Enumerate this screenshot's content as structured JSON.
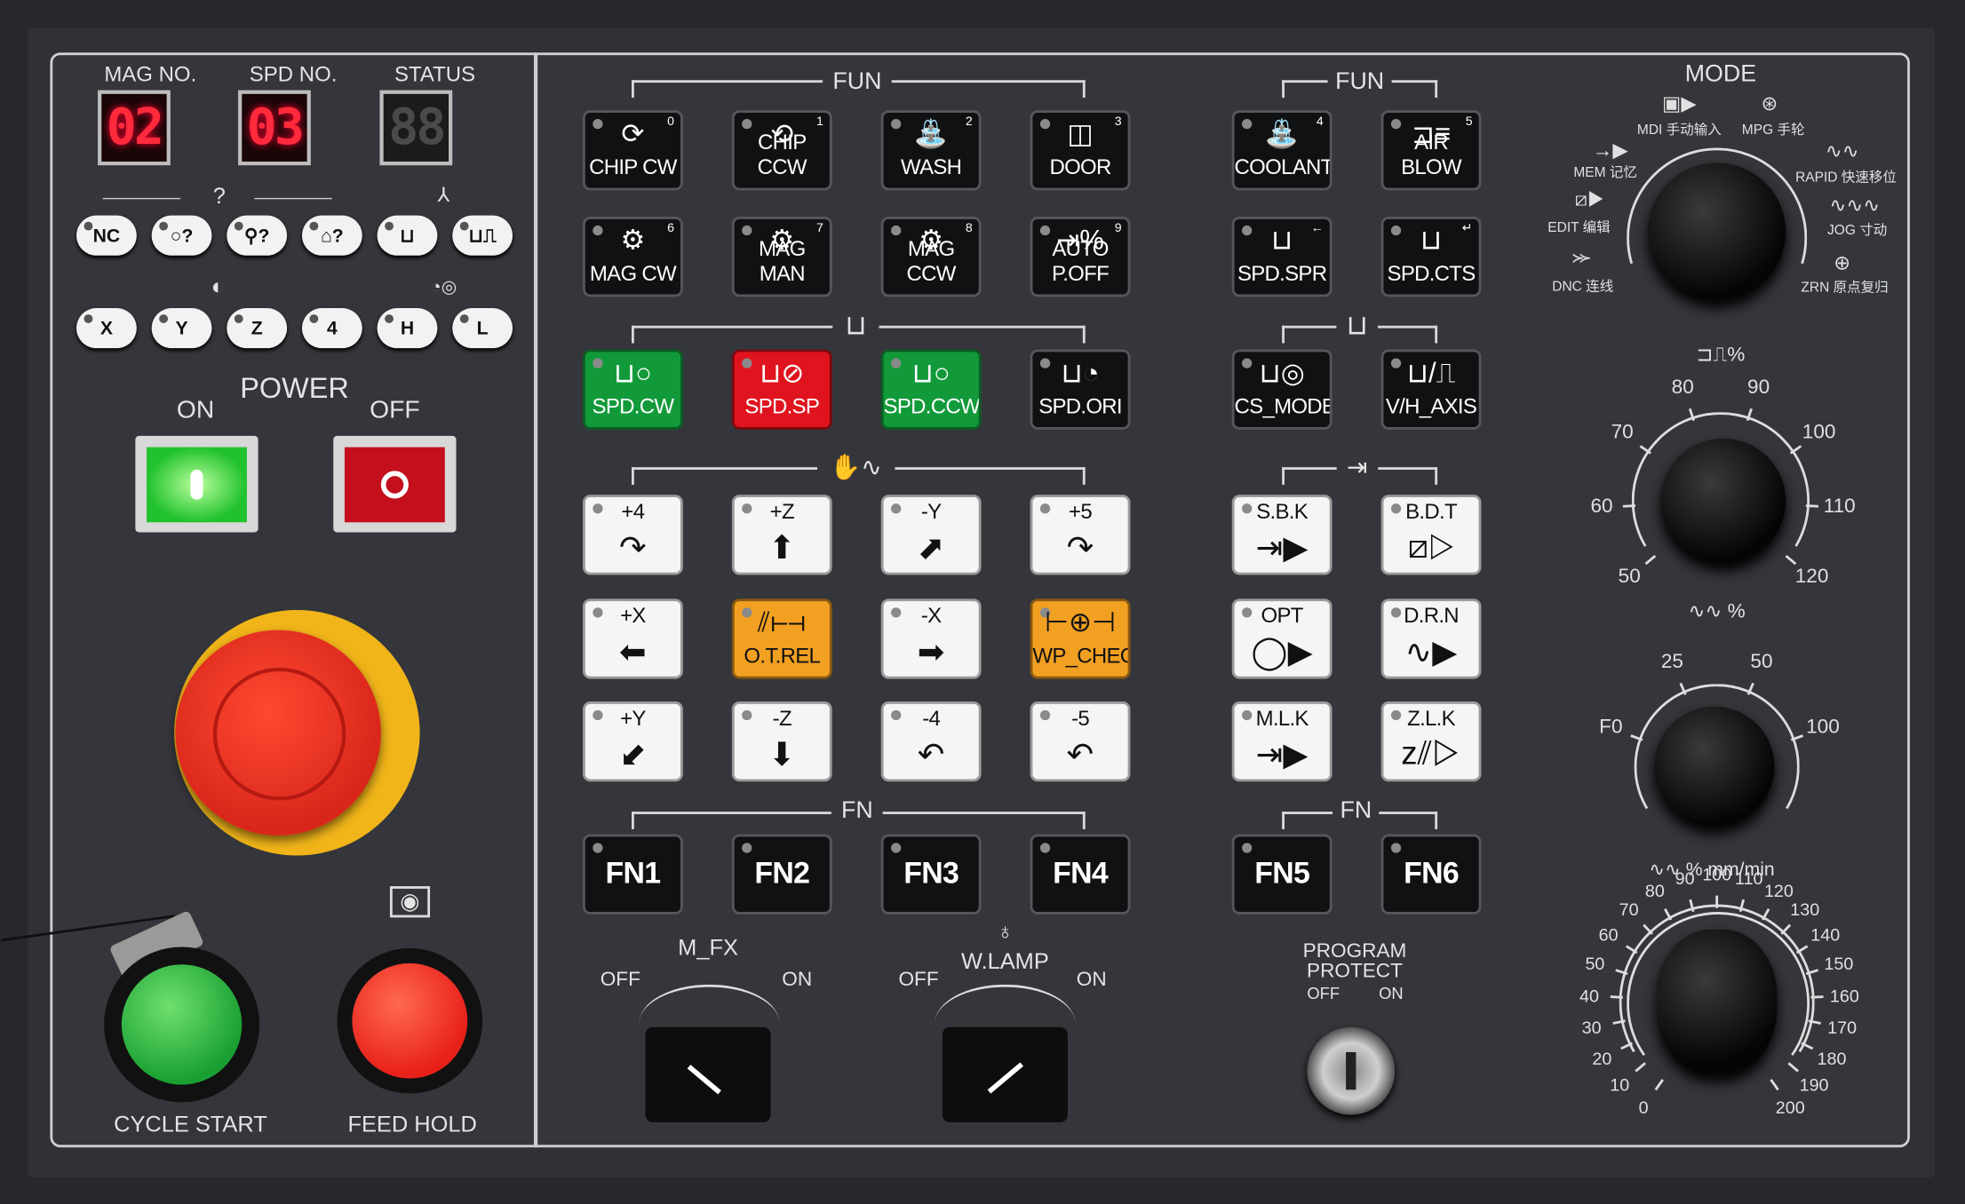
{
  "colors": {
    "panel": "#34363b",
    "accent_green": "#129a3a",
    "accent_red": "#e0141e",
    "accent_orange": "#f2a022",
    "segment_red": "#ff2a3c"
  },
  "displays": [
    {
      "label": "MAG NO.",
      "value": "02",
      "lit": true
    },
    {
      "label": "SPD NO.",
      "value": "03",
      "lit": true
    },
    {
      "label": "STATUS",
      "value": "88",
      "lit": false
    }
  ],
  "left": {
    "group1_label": "?",
    "round_buttons_row1": [
      {
        "label": "NC",
        "icon": "nc-icon"
      },
      {
        "label": "○?",
        "icon": "tool-query-icon"
      },
      {
        "label": "⚲?",
        "icon": "tool-query-icon"
      },
      {
        "label": "⌂?",
        "icon": "tool-query-icon"
      },
      {
        "label": "⊔",
        "icon": "spindle-icon"
      },
      {
        "label": "⊔⎍",
        "icon": "spindle-icon"
      }
    ],
    "round_buttons_row2": [
      {
        "label": "X"
      },
      {
        "label": "Y"
      },
      {
        "label": "Z"
      },
      {
        "label": "4"
      },
      {
        "label": "H"
      },
      {
        "label": "L"
      }
    ],
    "power": {
      "title": "POWER",
      "on": "ON",
      "off": "OFF"
    },
    "cycle_start": "CYCLE START",
    "feed_hold": "FEED HOLD"
  },
  "groups": {
    "fun_left": "FUN",
    "fun_right": "FUN",
    "fn_left": "FN",
    "fn_right": "FN"
  },
  "buttons": [
    {
      "label": "CHIP CW",
      "num": "0",
      "style": "black",
      "icon": "⟳"
    },
    {
      "label": "CHIP CCW",
      "num": "1",
      "style": "black",
      "icon": "⟲"
    },
    {
      "label": "WASH",
      "num": "2",
      "style": "black",
      "icon": "⛲"
    },
    {
      "label": "DOOR",
      "num": "3",
      "style": "black",
      "icon": "◫"
    },
    {
      "label": "COOLANT",
      "num": "4",
      "style": "black",
      "icon": "⛲"
    },
    {
      "label": "AIR BLOW",
      "num": "5",
      "style": "black",
      "icon": "⊐≡"
    },
    {
      "label": "MAG CW",
      "num": "6",
      "style": "black",
      "icon": "⚙"
    },
    {
      "label": "MAG MAN",
      "num": "7",
      "style": "black",
      "icon": "⚙"
    },
    {
      "label": "MAG CCW",
      "num": "8",
      "style": "black",
      "icon": "⚙"
    },
    {
      "label": "AUTO P.OFF",
      "num": "9",
      "style": "black",
      "icon": "⇥%"
    },
    {
      "label": "SPD.SPR",
      "num": "←",
      "style": "black",
      "icon": "⊔"
    },
    {
      "label": "SPD.CTS",
      "num": "↵",
      "style": "black",
      "icon": "⊔"
    },
    {
      "label": "SPD.CW",
      "num": "",
      "style": "green",
      "icon": "⊔○"
    },
    {
      "label": "SPD.SP",
      "num": "",
      "style": "red",
      "icon": "⊔⊘"
    },
    {
      "label": "SPD.CCW",
      "num": "",
      "style": "green",
      "icon": "⊔○"
    },
    {
      "label": "SPD.ORI",
      "num": "",
      "style": "black",
      "icon": "⊔◔"
    },
    {
      "label": "CS_MODE",
      "num": "",
      "style": "black",
      "icon": "⊔◎"
    },
    {
      "label": "V/H_AXIS",
      "num": "",
      "style": "black",
      "icon": "⊔/⎍"
    },
    {
      "label": "+4",
      "num": "",
      "style": "white",
      "icon": "↷"
    },
    {
      "label": "+Z",
      "num": "",
      "style": "white",
      "icon": "⬆"
    },
    {
      "label": "-Y",
      "num": "",
      "style": "white",
      "icon": "⬈"
    },
    {
      "label": "+5",
      "num": "",
      "style": "white",
      "icon": "↷"
    },
    {
      "label": "S.B.K",
      "num": "",
      "style": "white",
      "icon": "⇥▶"
    },
    {
      "label": "B.D.T",
      "num": "",
      "style": "white",
      "icon": "⧄▷"
    },
    {
      "label": "+X",
      "num": "",
      "style": "white",
      "icon": "⬅"
    },
    {
      "label": "O.T.REL",
      "num": "",
      "style": "orange",
      "icon": "⫽⊢⊣"
    },
    {
      "label": "-X",
      "num": "",
      "style": "white",
      "icon": "➡"
    },
    {
      "label": "WP_CHECK",
      "num": "",
      "style": "orange",
      "icon": "⊢⊕⊣"
    },
    {
      "label": "OPT",
      "num": "",
      "style": "white",
      "icon": "◯▶"
    },
    {
      "label": "D.R.N",
      "num": "",
      "style": "white",
      "icon": "∿▶"
    },
    {
      "label": "+Y",
      "num": "",
      "style": "white",
      "icon": "⬋"
    },
    {
      "label": "-Z",
      "num": "",
      "style": "white",
      "icon": "⬇"
    },
    {
      "label": "-4",
      "num": "",
      "style": "white",
      "icon": "↶"
    },
    {
      "label": "-5",
      "num": "",
      "style": "white",
      "icon": "↶"
    },
    {
      "label": "M.L.K",
      "num": "",
      "style": "white",
      "icon": "⇥▶"
    },
    {
      "label": "Z.L.K",
      "num": "",
      "style": "white",
      "icon": "z⫽▷"
    },
    {
      "label": "FN1",
      "num": "",
      "style": "fn",
      "icon": ""
    },
    {
      "label": "FN2",
      "num": "",
      "style": "fn",
      "icon": ""
    },
    {
      "label": "FN3",
      "num": "",
      "style": "fn",
      "icon": ""
    },
    {
      "label": "FN4",
      "num": "",
      "style": "fn",
      "icon": ""
    },
    {
      "label": "FN5",
      "num": "",
      "style": "fn",
      "icon": ""
    },
    {
      "label": "FN6",
      "num": "",
      "style": "fn",
      "icon": ""
    }
  ],
  "switches": {
    "mfx": {
      "label": "M_FX",
      "off": "OFF",
      "on": "ON",
      "state": "off"
    },
    "wlamp": {
      "label": "W.LAMP",
      "off": "OFF",
      "on": "ON",
      "state": "on"
    },
    "program_protect": {
      "label1": "PROGRAM",
      "label2": "PROTECT",
      "off": "OFF",
      "on": "ON"
    }
  },
  "mode": {
    "title": "MODE",
    "options": [
      "DNC 连线",
      "EDIT 编辑",
      "MEM 记忆",
      "MDI 手动输入",
      "MPG 手轮",
      "RAPID 快速移位",
      "JOG 寸动",
      "ZRN 原点复归"
    ],
    "selected": "MDI 手动输入"
  },
  "spindle_override": {
    "unit": "%",
    "ticks": [
      "50",
      "60",
      "70",
      "80",
      "90",
      "100",
      "110",
      "120"
    ],
    "value": "110"
  },
  "rapid_override": {
    "unit": "%",
    "ticks": [
      "F0",
      "25",
      "50",
      "100"
    ],
    "value": "100"
  },
  "feed_override": {
    "unit": "% mm/min",
    "ticks": [
      "0",
      "10",
      "20",
      "30",
      "40",
      "50",
      "60",
      "70",
      "80",
      "90",
      "100",
      "110",
      "120",
      "130",
      "140",
      "150",
      "160",
      "170",
      "180",
      "190",
      "200"
    ],
    "value": "100"
  }
}
